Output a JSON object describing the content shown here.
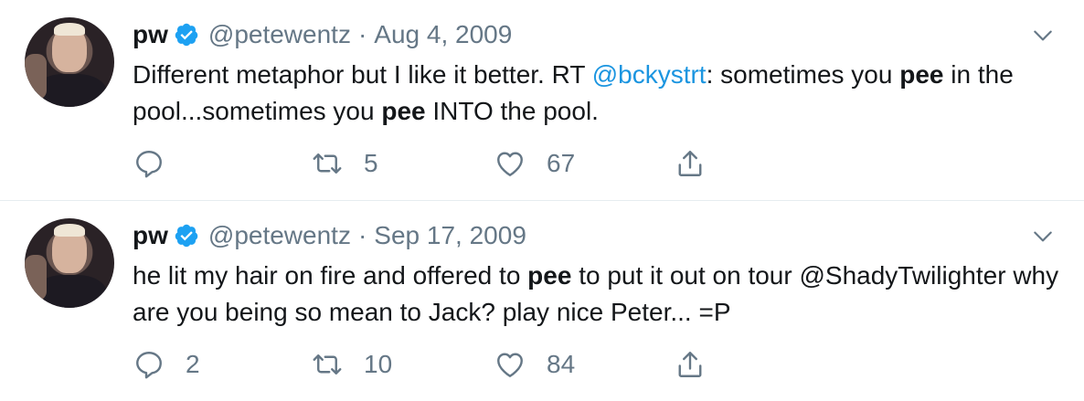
{
  "tweets": [
    {
      "name": "pw",
      "handle": "@petewentz",
      "separator": "·",
      "date": "Aug 4, 2009",
      "text_parts": [
        {
          "t": "Different metaphor but I like it better. RT "
        },
        {
          "t": "@bckystrt",
          "style": "mention"
        },
        {
          "t": ": sometimes you "
        },
        {
          "t": "pee",
          "style": "bold"
        },
        {
          "t": " in the pool...sometimes you "
        },
        {
          "t": "pee",
          "style": "bold"
        },
        {
          "t": " INTO the pool."
        }
      ],
      "replies": "",
      "retweets": "5",
      "likes": "67"
    },
    {
      "name": "pw",
      "handle": "@petewentz",
      "separator": "·",
      "date": "Sep 17, 2009",
      "text_parts": [
        {
          "t": "he lit my hair on fire and offered to "
        },
        {
          "t": "pee",
          "style": "bold"
        },
        {
          "t": " to put it out on tour @ShadyTwilighter why are you being so mean to Jack? play nice Peter... =P"
        }
      ],
      "replies": "2",
      "retweets": "10",
      "likes": "84"
    }
  ],
  "icons": {
    "verified": "verified-badge-icon",
    "chevron": "chevron-down-icon",
    "reply": "reply-icon",
    "retweet": "retweet-icon",
    "like": "heart-icon",
    "share": "share-icon"
  },
  "colors": {
    "text": "#14171a",
    "secondary": "#657786",
    "accent": "#1da1f2",
    "mention": "#1b95e0",
    "divider": "#e6ecf0"
  }
}
